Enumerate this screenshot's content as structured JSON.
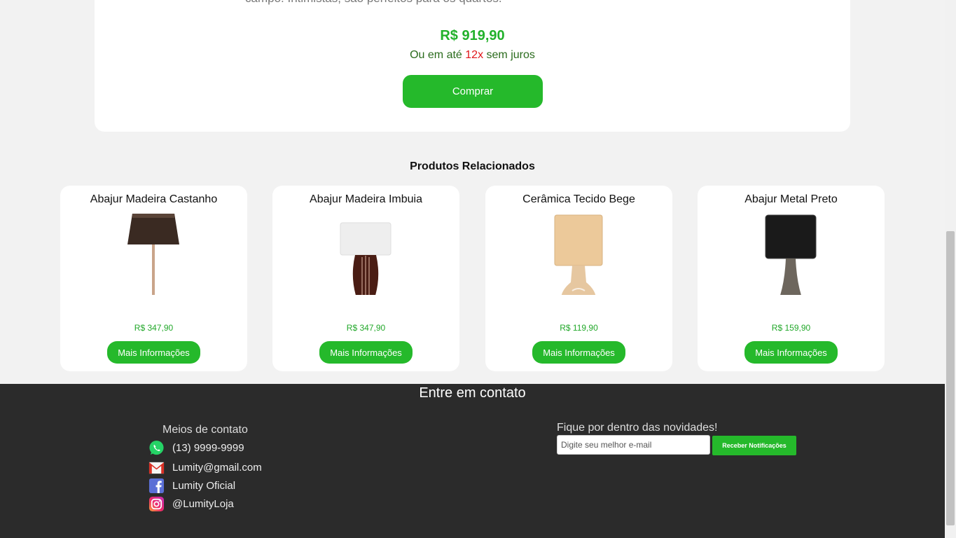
{
  "product": {
    "description_tail": "campo. Intimistas, são perfeitos para os quartos.",
    "price": "R$ 919,90",
    "installments_prefix": "Ou em até",
    "installments_count": "12x",
    "installments_suffix": "sem juros",
    "buy_label": "Comprar"
  },
  "related": {
    "title": "Produtos Relacionados",
    "more_label": "Mais Informações",
    "items": [
      {
        "name": "Abajur Madeira Castanho",
        "price": "R$ 347,90"
      },
      {
        "name": "Abajur Madeira Imbuia",
        "price": "R$ 347,90"
      },
      {
        "name": "Cerâmica Tecido Bege",
        "price": "R$ 119,90"
      },
      {
        "name": "Abajur Metal Preto",
        "price": "R$ 159,90"
      }
    ]
  },
  "footer": {
    "title": "Entre em contato",
    "contacts_title": "Meios de contato",
    "contacts": [
      {
        "icon": "whatsapp-icon",
        "text": "(13) 9999-9999"
      },
      {
        "icon": "gmail-icon",
        "text": "Lumity@gmail.com"
      },
      {
        "icon": "facebook-icon",
        "text": "Lumity Oficial"
      },
      {
        "icon": "instagram-icon",
        "text": "@LumityLoja"
      }
    ],
    "newsletter_title": "Fique por dentro das novidades!",
    "email_placeholder": "Digite seu melhor e-mail",
    "notify_label": "Receber Notificações"
  },
  "colors": {
    "accent": "#25b92b",
    "footer_bg": "#2b2b2b",
    "page_bg": "#f2f2f2"
  }
}
